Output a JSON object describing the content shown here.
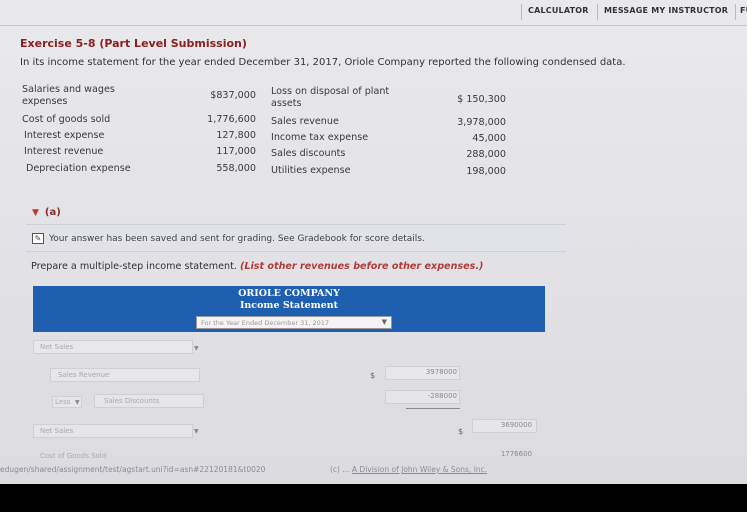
{
  "topbar": {
    "calculator": "CALCULATOR",
    "message_instructor": "MESSAGE MY INSTRUCTOR",
    "more": "FU"
  },
  "exercise": {
    "title": "Exercise 5-8 (Part Level Submission)",
    "intro": "In its income statement for the year ended December 31, 2017, Oriole Company reported the following condensed data."
  },
  "data_left": [
    {
      "label": "Salaries and wages expenses",
      "value": "$837,000"
    },
    {
      "label": "Cost of goods sold",
      "value": "1,776,600"
    },
    {
      "label": "Interest expense",
      "value": "127,800"
    },
    {
      "label": "Interest revenue",
      "value": "117,000"
    },
    {
      "label": "Depreciation expense",
      "value": "558,000"
    }
  ],
  "data_right": [
    {
      "label": "Loss on disposal of plant assets",
      "value": "$ 150,300"
    },
    {
      "label": "Sales revenue",
      "value": "3,978,000"
    },
    {
      "label": "Income tax expense",
      "value": "45,000"
    },
    {
      "label": "Sales discounts",
      "value": "288,000"
    },
    {
      "label": "Utilities expense",
      "value": "198,000"
    }
  ],
  "part": {
    "toggle_label": "(a)",
    "saved_message": "Your answer has been saved and sent for grading. See Gradebook for score details.",
    "prompt": "Prepare a multiple-step income statement.",
    "prompt_note": "(List other revenues before other expenses.)"
  },
  "statement": {
    "company": "ORIOLE COMPANY",
    "title": "Income Statement",
    "period": "For the Year Ended December 31, 2017"
  },
  "form": {
    "row1_label": "Net Sales",
    "row2_label": "Sales Revenue",
    "row2_amount": "3978000",
    "row3_less": "Less",
    "row3_label": "Sales Discounts",
    "row3_amount": "-288000",
    "row4_label": "Net Sales",
    "row4_amount": "3690000",
    "row5_label": "Cost of Goods Sold",
    "row5_amount": "1776600",
    "dollar": "$"
  },
  "footer": {
    "url": "edugen/shared/assignment/test/agstart.uni?id=asn#22120181&t0020",
    "copyright_prefix": "(c) ...",
    "copyright_link": "A Division of John Wiley & Sons, Inc."
  }
}
